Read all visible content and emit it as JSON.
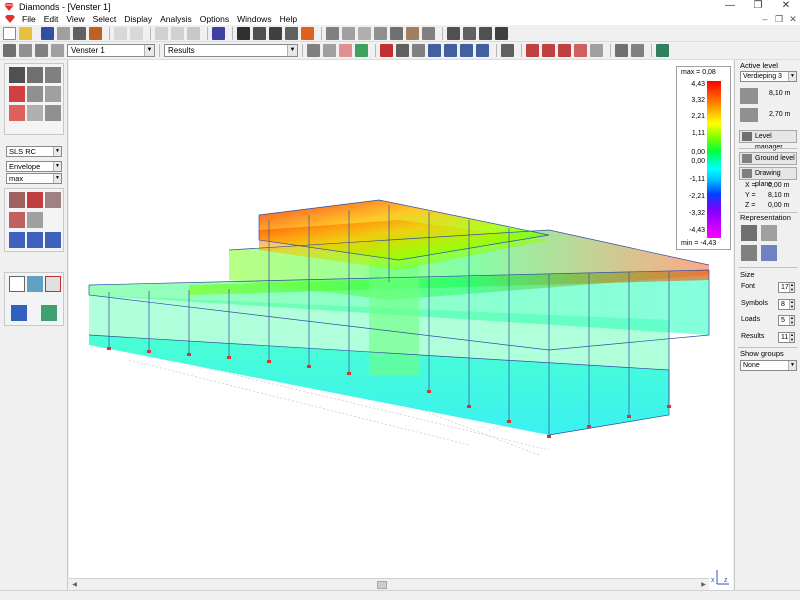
{
  "window": {
    "title": "Diamonds - [Venster 1]",
    "controls": [
      "—",
      "❐",
      "✕"
    ]
  },
  "menu": {
    "items": [
      "File",
      "Edit",
      "View",
      "Select",
      "Display",
      "Analysis",
      "Options",
      "Windows",
      "Help"
    ],
    "doc_controls": [
      "–",
      "❐",
      "✕"
    ]
  },
  "toolbar2": {
    "window_combo": "Venster 1",
    "results_combo": "Results"
  },
  "left_panel": {
    "combo1": "SLS RC",
    "combo2": "Envelope",
    "combo3": "max"
  },
  "legend": {
    "max_label": "max = 0,08",
    "min_label": "min = -4,43",
    "ticks": [
      "4,43",
      "3,32",
      "2,21",
      "1,11",
      "0,00",
      "0,00",
      "-1,11",
      "-2,21",
      "-3,32",
      "-4,43"
    ]
  },
  "right_panel": {
    "active_level_label": "Active level",
    "active_level_value": "Verdieping 3",
    "level_height_1": "8,10 m",
    "level_height_2": "2,70 m",
    "level_manager": "Level manager",
    "ground_level": "Ground level",
    "drawing_plane": "Drawing plane",
    "coords": {
      "x_label": "X =",
      "x_value": "0,00 m",
      "y_label": "Y =",
      "y_value": "8,10 m",
      "z_label": "Z =",
      "z_value": "0,00 m"
    },
    "representation_label": "Representation",
    "size_label": "Size",
    "font_label": "Font",
    "font_value": "17",
    "symbols_label": "Symbols",
    "symbols_value": "8",
    "loads_label": "Loads",
    "loads_value": "5",
    "results_label": "Results",
    "results_value": "11",
    "show_groups_label": "Show groups",
    "show_groups_value": "None"
  },
  "axis": {
    "x": "x",
    "z": "z"
  }
}
